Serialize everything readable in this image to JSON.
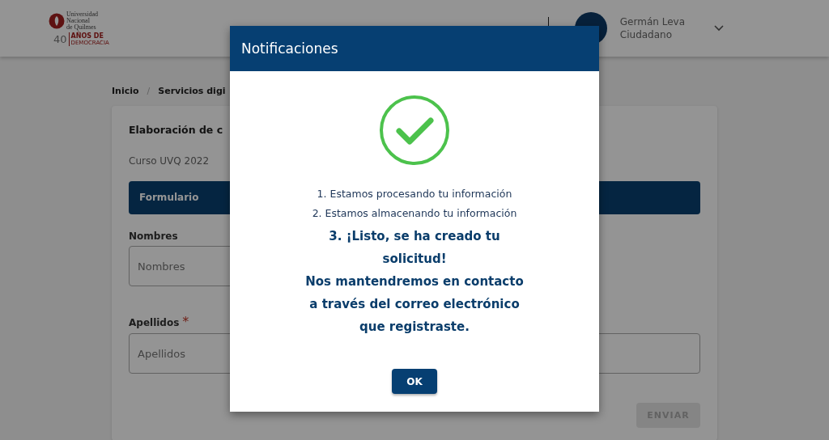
{
  "header": {
    "logo": {
      "line_1": "Universidad",
      "line_2": "Nacional",
      "line_3": "de Quilmes",
      "years": "40",
      "tagline_1": "AÑOS DE",
      "tagline_2": "DEMOCRACIA"
    },
    "user": {
      "name": "Germán Leva",
      "role": "Ciudadano"
    }
  },
  "breadcrumb": [
    {
      "label": "Inicio"
    },
    {
      "separator": "/",
      "label": "Servicios digi"
    }
  ],
  "card": {
    "title": "Elaboración de c",
    "subtitle": "Curso UVQ 2022",
    "section": "Formulario",
    "fields": [
      {
        "kind": "half",
        "label": "Nombres",
        "placeholder": "Nombres"
      },
      {
        "kind": "full",
        "label": "Apellidos",
        "required_mark": "*",
        "placeholder": "Apellidos"
      }
    ],
    "submit": {
      "label": "ENVIAR",
      "disabled": true
    }
  },
  "modal": {
    "title": "Notificaciones",
    "steps": [
      "1. Estamos procesando tu información",
      "2. Estamos almacenando tu información"
    ],
    "final_message": [
      "3. ¡Listo, se ha creado tu",
      "solicitud!",
      "Nos mantendremos en contacto",
      "a través del correo electrónico",
      "que registraste."
    ],
    "ok": "OK"
  }
}
